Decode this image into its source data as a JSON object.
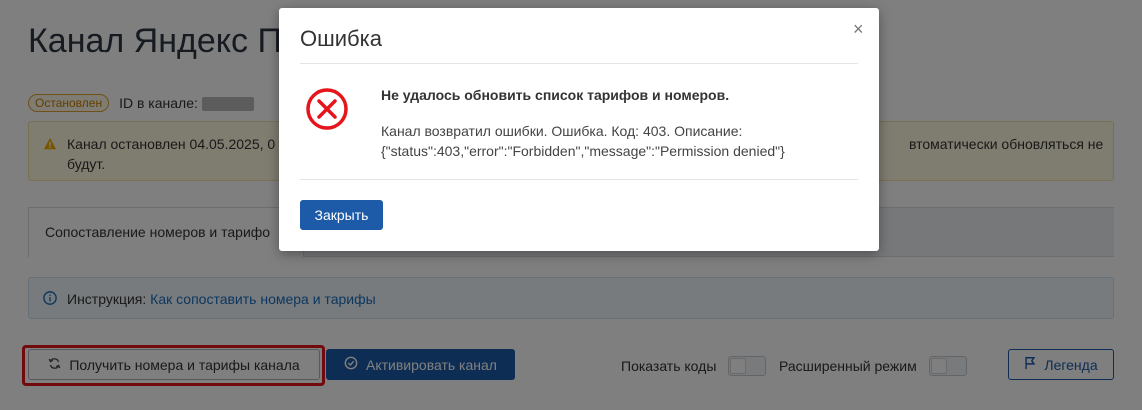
{
  "page": {
    "title": "Канал Яндекс Пу",
    "status_badge": "Остановлен",
    "channel_id_label": "ID в канале:",
    "warning_left": "Канал остановлен 04.05.2025, 0",
    "warning_left_line2": "будут.",
    "warning_right": "втоматически обновляться не",
    "tab_active_label": "Сопоставление номеров и тарифо",
    "instruction_label": "Инструкция:",
    "instruction_link": "Как сопоставить номера и тарифы"
  },
  "actions": {
    "get_numbers_label": "Получить номера и тарифы канала",
    "activate_label": "Активировать канал",
    "show_codes_label": "Показать коды",
    "advanced_mode_label": "Расширенный режим",
    "legend_label": "Легенда"
  },
  "modal": {
    "title": "Ошибка",
    "close_symbol": "×",
    "heading": "Не удалось обновить список тарифов и номеров.",
    "body": "Канал возвратил ошибки. Ошибка. Код: 403. Описание: {\"status\":403,\"error\":\"Forbidden\",\"message\":\"Permission denied\"}",
    "close_button_label": "Закрыть"
  },
  "colors": {
    "primary": "#1d5ba8",
    "error": "#e5151b",
    "warning_bg": "#fff9e0",
    "info_bg": "#eef6fb"
  },
  "icons": {
    "warning": "warning-icon",
    "info": "info-icon",
    "refresh": "refresh-icon",
    "check": "check-circle-icon",
    "flag": "flag-icon",
    "error": "error-circle-x-icon",
    "close": "close-icon"
  }
}
